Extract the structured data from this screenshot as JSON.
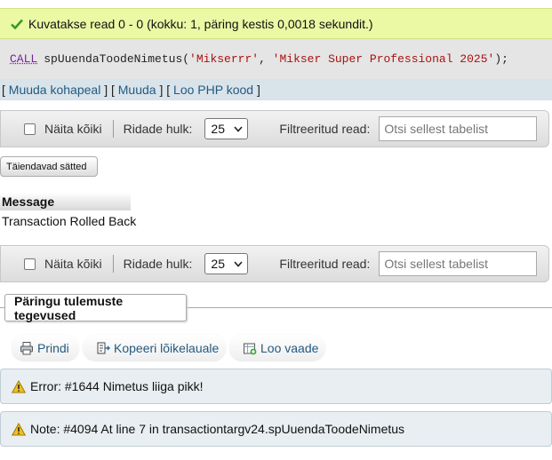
{
  "result": {
    "success_text": "Kuvatakse read 0 - 0 (kokku: 1, päring kestis 0,0018 sekundit.)",
    "icon": "check-icon"
  },
  "sql": {
    "keyword": "CALL",
    "procedure": "spUuendaToodeNimetus(",
    "arg1": "'Mikserrr'",
    "comma": ", ",
    "arg2": "'Mikser Super Professional 2025'",
    "tail": ");"
  },
  "links": {
    "edit_inline": "Muuda kohapeal",
    "edit": "Muuda",
    "create_php": "Loo PHP kood",
    "open": "[ ",
    "mid": " ] [ ",
    "close": " ]"
  },
  "navbar": {
    "show_all": "Näita kõiki",
    "rows_label": "Ridade hulk:",
    "rows_value": "25",
    "filter_label": "Filtreeritud read:",
    "filter_placeholder": "Otsi sellest tabelist"
  },
  "extra_settings": "Täiendavad sätted",
  "table": {
    "header": "Message",
    "rows": [
      "Transaction Rolled Back"
    ]
  },
  "operations": {
    "legend": "Päringu tulemuste tegevused",
    "print": "Prindi",
    "copy": "Kopeeri lõikelauale",
    "create_view": "Loo vaade"
  },
  "notices": [
    {
      "text": "Error: #1644 Nimetus liiga pikk!",
      "icon": "warning-icon"
    },
    {
      "text": "Note: #4094 At line 7 in transactiontargv24.spUuendaToodeNimetus",
      "icon": "warning-icon"
    }
  ],
  "colors": {
    "success_bg": "#ebf8a4",
    "link": "#235a81",
    "sql_string": "#aa1111",
    "notice_bg": "#e8eef1"
  }
}
